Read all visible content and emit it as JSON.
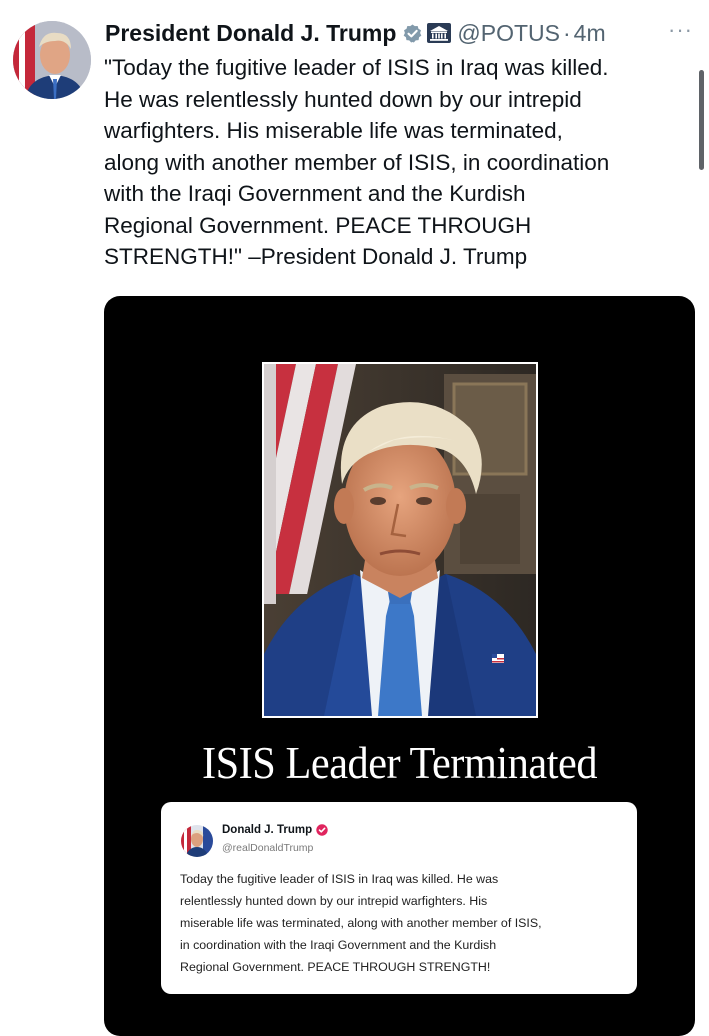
{
  "post": {
    "author_name": "President Donald J. Trump",
    "handle": "@POTUS",
    "separator": "·",
    "time": "4m",
    "more_label": "···",
    "text_lines": [
      "\"Today the fugitive leader of ISIS in Iraq was killed.",
      "He was relentlessly hunted down by our intrepid",
      "warfighters. His miserable life was terminated,",
      "along with another member of ISIS, in coordination",
      "with the Iraqi Government and the Kurdish",
      "Regional Government. PEACE THROUGH",
      "STRENGTH!\" –President Donald J. Trump"
    ]
  },
  "media": {
    "headline": "ISIS Leader Terminated",
    "quote": {
      "name": "Donald J. Trump",
      "handle": "@realDonaldTrump",
      "text_lines": [
        "Today the fugitive leader of ISIS in Iraq was killed. He was",
        "relentlessly hunted down by our intrepid warfighters. His",
        "miserable life was terminated, along with another member of ISIS,",
        "in coordination with the Iraqi Government and the Kurdish",
        "Regional Government. PEACE THROUGH STRENGTH!"
      ]
    }
  },
  "colors": {
    "verified_badge_gray": "#829aab",
    "verified_badge_red": "#e0245e",
    "secondary_text": "#536471",
    "media_background": "#000000"
  },
  "icons": {
    "verified": "verified-badge-icon",
    "government": "government-building-icon",
    "more": "more-options-icon"
  }
}
